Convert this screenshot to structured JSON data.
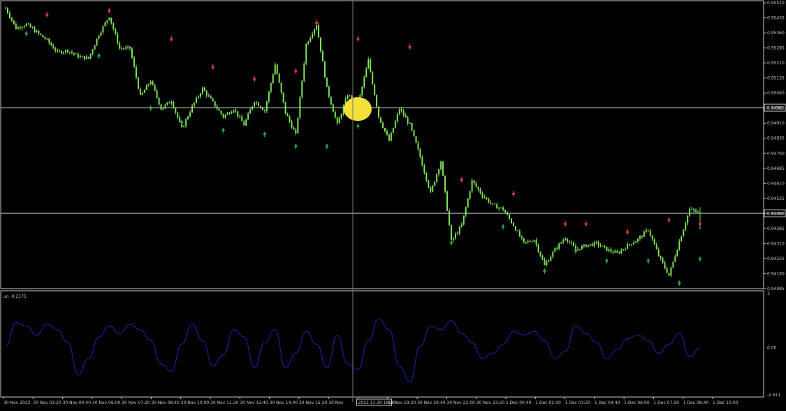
{
  "colors": {
    "background": "#000000",
    "candle": "#7ee35a",
    "grid_line": "#c8c8c8",
    "up_arrow": "#2faa3a",
    "down_arrow": "#e23b3b",
    "oscillator": "#1c1f8e",
    "highlight": "#ffeb3b",
    "axis_text": "#c8c8c8",
    "crosshair": "#7a7a7a"
  },
  "main_chart": {
    "price_axis_labels": [
      "0.95510",
      "0.95435",
      "0.95360",
      "0.95285",
      "0.95210",
      "0.95135",
      "0.95060",
      "0.94985",
      "0.94910",
      "0.94835",
      "0.94760",
      "0.94685",
      "0.94610",
      "0.94535",
      "0.94460",
      "0.94385",
      "0.94310",
      "0.94235",
      "0.94160",
      "0.94085"
    ],
    "horizontal_levels": [
      {
        "label": "0.94985",
        "price": 0.94985,
        "type": "crosshair-level"
      },
      {
        "label": "0.94460",
        "price": 0.9446,
        "type": "current-price"
      }
    ],
    "up_arrow_icon": "up-arrow-icon",
    "down_arrow_icon": "down-arrow-icon"
  },
  "indicator": {
    "label": "un -0.2175",
    "axis_labels": [
      "3",
      "0.00",
      "-2.611"
    ]
  },
  "time_axis": {
    "labels": [
      "30 Nov 2022",
      "30 Nov 03:20",
      "30 Nov 04:40",
      "30 Nov 06:00",
      "30 Nov 07:20",
      "30 Nov 08:40",
      "30 Nov 10:00",
      "30 Nov 11:20",
      "30 Nov 12:40",
      "30 Nov 14:00",
      "30 Nov 15:20",
      "30 Nov",
      "2022.11.30 18:20",
      "30 Nov 19:20",
      "30 Nov 20:40",
      "30 Nov 22:00",
      "30 Nov 23:20",
      "1 Dec 00:40",
      "1 Dec 02:00",
      "1 Dec 03:20",
      "1 Dec 04:40",
      "1 Dec 06:00",
      "1 Dec 07:20",
      "1 Dec 08:40",
      "1 Dec 10:00"
    ],
    "crosshair_label": "2022.11.30 18:20"
  },
  "chart_data": {
    "type": "line",
    "title": "",
    "xlabel": "",
    "ylabel": "",
    "ylim": [
      0.94085,
      0.9551
    ],
    "series": [
      {
        "values": [
          0.9548,
          0.9538,
          0.954,
          0.9536,
          0.9532,
          0.9526,
          0.9527,
          0.9524,
          0.9523,
          0.9535,
          0.9544,
          0.9528,
          0.9528,
          0.9504,
          0.9512,
          0.9498,
          0.9502,
          0.9488,
          0.9499,
          0.9508,
          0.9501,
          0.9494,
          0.9498,
          0.949,
          0.9502,
          0.9497,
          0.952,
          0.9496,
          0.9485,
          0.953,
          0.954,
          0.9508,
          0.949,
          0.9505,
          0.95,
          0.9522,
          0.9494,
          0.9482,
          0.9498,
          0.949,
          0.9474,
          0.9456,
          0.9472,
          0.9432,
          0.944,
          0.9462,
          0.9455,
          0.945,
          0.9448,
          0.944,
          0.9431,
          0.9433,
          0.942,
          0.9428,
          0.9434,
          0.9428,
          0.943,
          0.9431,
          0.9428,
          0.9426,
          0.943,
          0.9433,
          0.9438,
          0.9425,
          0.9415,
          0.9432,
          0.9448,
          0.9446
        ]
      }
    ],
    "arrows": {
      "down": [
        {
          "i": 4,
          "price": 0.9544
        },
        {
          "i": 10,
          "price": 0.9546
        },
        {
          "i": 16,
          "price": 0.9532
        },
        {
          "i": 20,
          "price": 0.9518
        },
        {
          "i": 24,
          "price": 0.9512
        },
        {
          "i": 28,
          "price": 0.9516
        },
        {
          "i": 30,
          "price": 0.954
        },
        {
          "i": 34,
          "price": 0.9532
        },
        {
          "i": 39,
          "price": 0.9528
        },
        {
          "i": 44,
          "price": 0.9462
        },
        {
          "i": 49,
          "price": 0.9455
        },
        {
          "i": 54,
          "price": 0.944
        },
        {
          "i": 56,
          "price": 0.944
        },
        {
          "i": 60,
          "price": 0.9436
        },
        {
          "i": 64,
          "price": 0.9442
        },
        {
          "i": 67,
          "price": 0.944
        }
      ],
      "up": [
        {
          "i": 2,
          "price": 0.9536
        },
        {
          "i": 9,
          "price": 0.9525
        },
        {
          "i": 14,
          "price": 0.9499
        },
        {
          "i": 17,
          "price": 0.9492
        },
        {
          "i": 21,
          "price": 0.9488
        },
        {
          "i": 25,
          "price": 0.9486
        },
        {
          "i": 28,
          "price": 0.948
        },
        {
          "i": 31,
          "price": 0.948
        },
        {
          "i": 34,
          "price": 0.949
        },
        {
          "i": 43,
          "price": 0.9432
        },
        {
          "i": 48,
          "price": 0.944
        },
        {
          "i": 52,
          "price": 0.9418
        },
        {
          "i": 55,
          "price": 0.9428
        },
        {
          "i": 58,
          "price": 0.9423
        },
        {
          "i": 62,
          "price": 0.9423
        },
        {
          "i": 65,
          "price": 0.9412
        },
        {
          "i": 67,
          "price": 0.9424
        }
      ]
    },
    "oscillator": {
      "ylim": [
        -2.611,
        3
      ],
      "values": [
        0.1,
        1.4,
        1.2,
        0.7,
        1.3,
        1.0,
        0.3,
        -1.5,
        -0.6,
        0.6,
        1.2,
        0.8,
        1.3,
        1.0,
        0.4,
        -0.9,
        -1.3,
        0.2,
        1.3,
        0.4,
        -1.0,
        -0.4,
        1.0,
        0.6,
        -1.1,
        0.3,
        1.0,
        -1.1,
        -0.3,
        0.9,
        0.2,
        -1.1,
        0.7,
        -0.9,
        -1.2,
        0.4,
        1.6,
        1.0,
        -1.0,
        -1.9,
        0.1,
        1.2,
        1.0,
        1.5,
        0.8,
        0.3,
        -0.6,
        -0.3,
        0.2,
        0.9,
        0.7,
        0.9,
        0.4,
        -0.6,
        -0.2,
        1.2,
        0.8,
        0.3,
        -0.6,
        -0.1,
        0.5,
        0.7,
        0.4,
        -0.3,
        0.2,
        0.8,
        -0.5,
        0.0
      ]
    }
  }
}
